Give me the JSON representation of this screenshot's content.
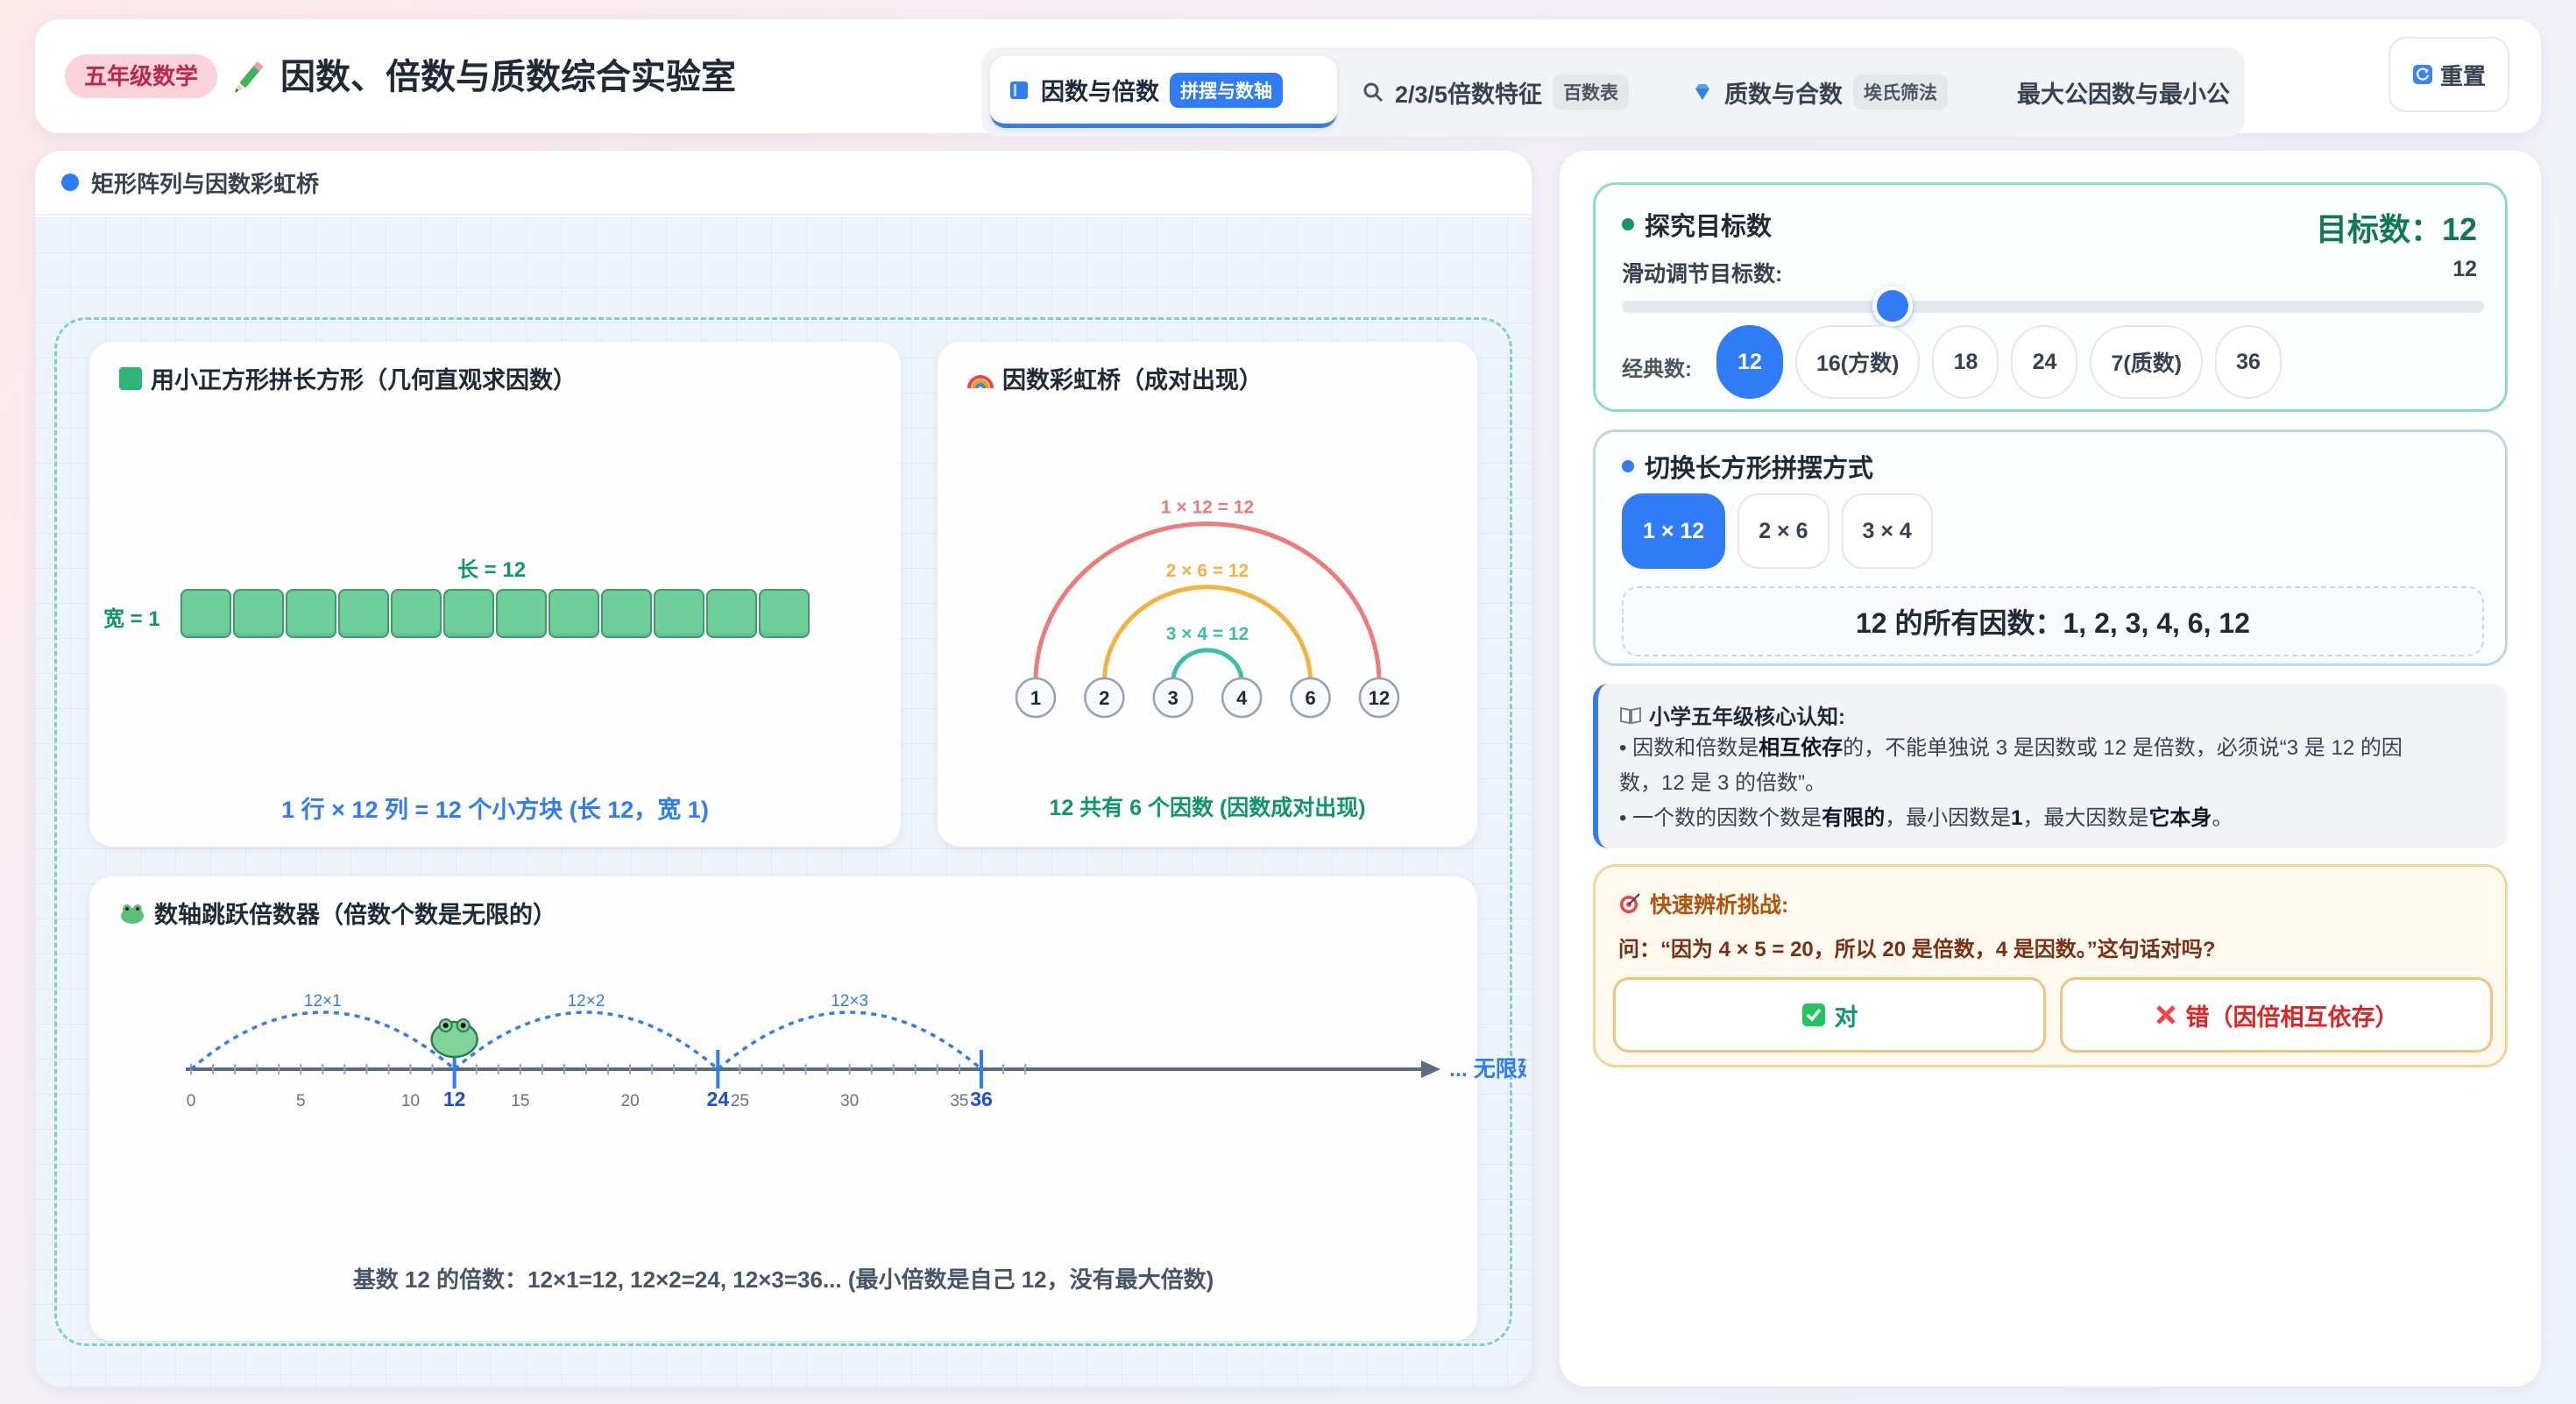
{
  "header": {
    "grade": "五年级数学",
    "title": "因数、倍数与质数综合实验室",
    "reset_label": "重置"
  },
  "tabs": [
    {
      "label": "因数与倍数",
      "chip": "拼摆与数轴",
      "icon": "book-icon",
      "active": true
    },
    {
      "label": "2/3/5倍数特征",
      "chip": "百数表",
      "icon": "magnifier-icon",
      "active": false
    },
    {
      "label": "质数与合数",
      "chip": "埃氏筛法",
      "icon": "gem-icon",
      "active": false
    },
    {
      "label": "最大公因数与最小公",
      "chip": "",
      "icon": "scale-icon",
      "active": false
    }
  ],
  "left_panel": {
    "title": "矩形阵列与因数彩虹桥",
    "rect_card": {
      "title": "用小正方形拼长方形（几何直观求因数）",
      "length_label": "长 = 12",
      "width_label": "宽 = 1",
      "rows": 1,
      "cols": 12,
      "caption": "1 行 × 12 列 = 12 个小方块 (长 12，宽 1)"
    },
    "rainbow_card": {
      "title": "因数彩虹桥（成对出现）",
      "factors": [
        "1",
        "2",
        "3",
        "4",
        "6",
        "12"
      ],
      "pairs": [
        {
          "label": "1 × 12 = 12",
          "color": "#ef7a7a"
        },
        {
          "label": "2 × 6 = 12",
          "color": "#f4b23f"
        },
        {
          "label": "3 × 4 = 12",
          "color": "#3bbfa7"
        }
      ],
      "caption": "12 共有 6 个因数 (因数成对出现)"
    },
    "numberline_card": {
      "title": "数轴跳跃倍数器（倍数个数是无限的）",
      "ticks": [
        "0",
        "5",
        "10",
        "15",
        "20",
        "25",
        "30",
        "35"
      ],
      "multiples": [
        "12",
        "24",
        "36"
      ],
      "jump_labels": [
        "12×1",
        "12×2",
        "12×3"
      ],
      "extend_label": "... 无限延伸",
      "caption": "基数 12 的倍数：12×1=12, 12×2=24, 12×3=36... (最小倍数是自己 12，没有最大倍数)"
    }
  },
  "right_panel": {
    "target": {
      "title": "探究目标数",
      "value_label": "目标数：12",
      "slider_label": "滑动调节目标数:",
      "slider_value": "12",
      "slider_min": 1,
      "slider_max": 36,
      "slider_current": 12,
      "presets_label": "经典数:",
      "presets": [
        "12",
        "16(方数)",
        "18",
        "24",
        "7(质数)",
        "36"
      ],
      "active_preset": 0
    },
    "rect_switch": {
      "title": "切换长方形拼摆方式",
      "options": [
        "1 × 12",
        "2 × 6",
        "3 × 4"
      ],
      "active": 0,
      "factors_text": "12 的所有因数：1, 2, 3, 4, 6, 12"
    },
    "note": {
      "title": "小学五年级核心认知:",
      "line1_a": "• 因数和倍数是",
      "line1_b": "相互依存",
      "line1_c": "的，不能单独说 3 是因数或 12 是倍数，必须说“3 是 12 的因",
      "line2": "数，12 是 3 的倍数”。",
      "line3_a": "• 一个数的因数个数是",
      "line3_b": "有限的",
      "line3_c": "，最小因数是",
      "line3_d": "1",
      "line3_e": "，最大因数是",
      "line3_f": "它本身",
      "line3_g": "。"
    },
    "quiz": {
      "title": "快速辨析挑战:",
      "question": "问：“因为 4 × 5 = 20，所以 20 是倍数，4 是因数。”这句话对吗?",
      "option_true": "对",
      "option_false": "错（因倍相互依存）"
    }
  },
  "colors": {
    "accent": "#2f7cf6",
    "green": "#10966b",
    "block": "#6fcf9b",
    "line": "#5a6b86"
  }
}
